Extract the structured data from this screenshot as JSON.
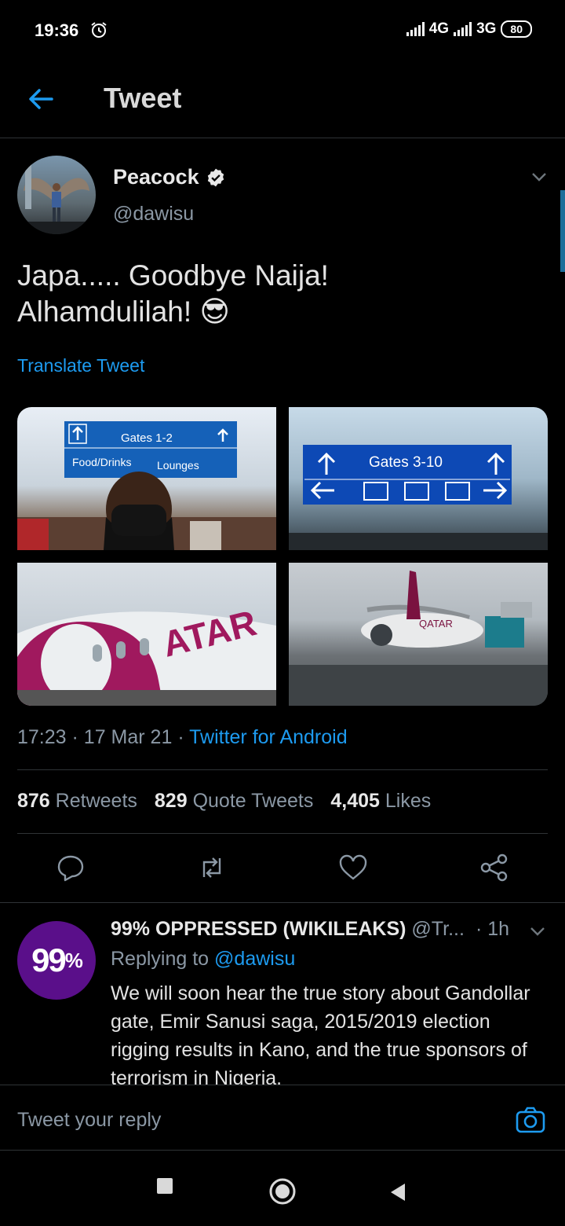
{
  "status": {
    "time": "19:36",
    "net1": "4G",
    "net2": "3G",
    "battery": "80"
  },
  "header": {
    "title": "Tweet"
  },
  "tweet": {
    "author_name": "Peacock",
    "handle": "@dawisu",
    "text_line1": "Japa..... Goodbye Naija!",
    "text_line2": "Alhamdulilah! 😎",
    "translate": "Translate Tweet",
    "photos": [
      {
        "sign": "Gates 1-2",
        "sub1": "Food/Drinks",
        "sub2": "Lounges"
      },
      {
        "sign": "Gates 3-10"
      },
      {
        "livery": "ATAR"
      },
      {
        "livery": "QATAR"
      }
    ],
    "time": "17:23",
    "date": "17 Mar 21",
    "client": "Twitter for Android",
    "retweets_count": "876",
    "retweets_label": "Retweets",
    "quotes_count": "829",
    "quotes_label": "Quote Tweets",
    "likes_count": "4,405",
    "likes_label": "Likes"
  },
  "reply": {
    "avatar_text": "99",
    "avatar_suffix": "%",
    "name": "99% OPPRESSED (WIKILEAKS)",
    "handle": "@Tr...",
    "time": "· 1h",
    "replying_prefix": "Replying to",
    "replying_to": "@dawisu",
    "text": "We will soon hear the true story about Gandollar gate, Emir Sanusi saga, 2015/2019 election rigging results in Kano, and the true sponsors of terrorism in Nigeria."
  },
  "composer": {
    "placeholder": "Tweet your reply"
  },
  "colors": {
    "accent": "#1d9bf0",
    "background": "#000000",
    "muted": "#8b98a5"
  }
}
